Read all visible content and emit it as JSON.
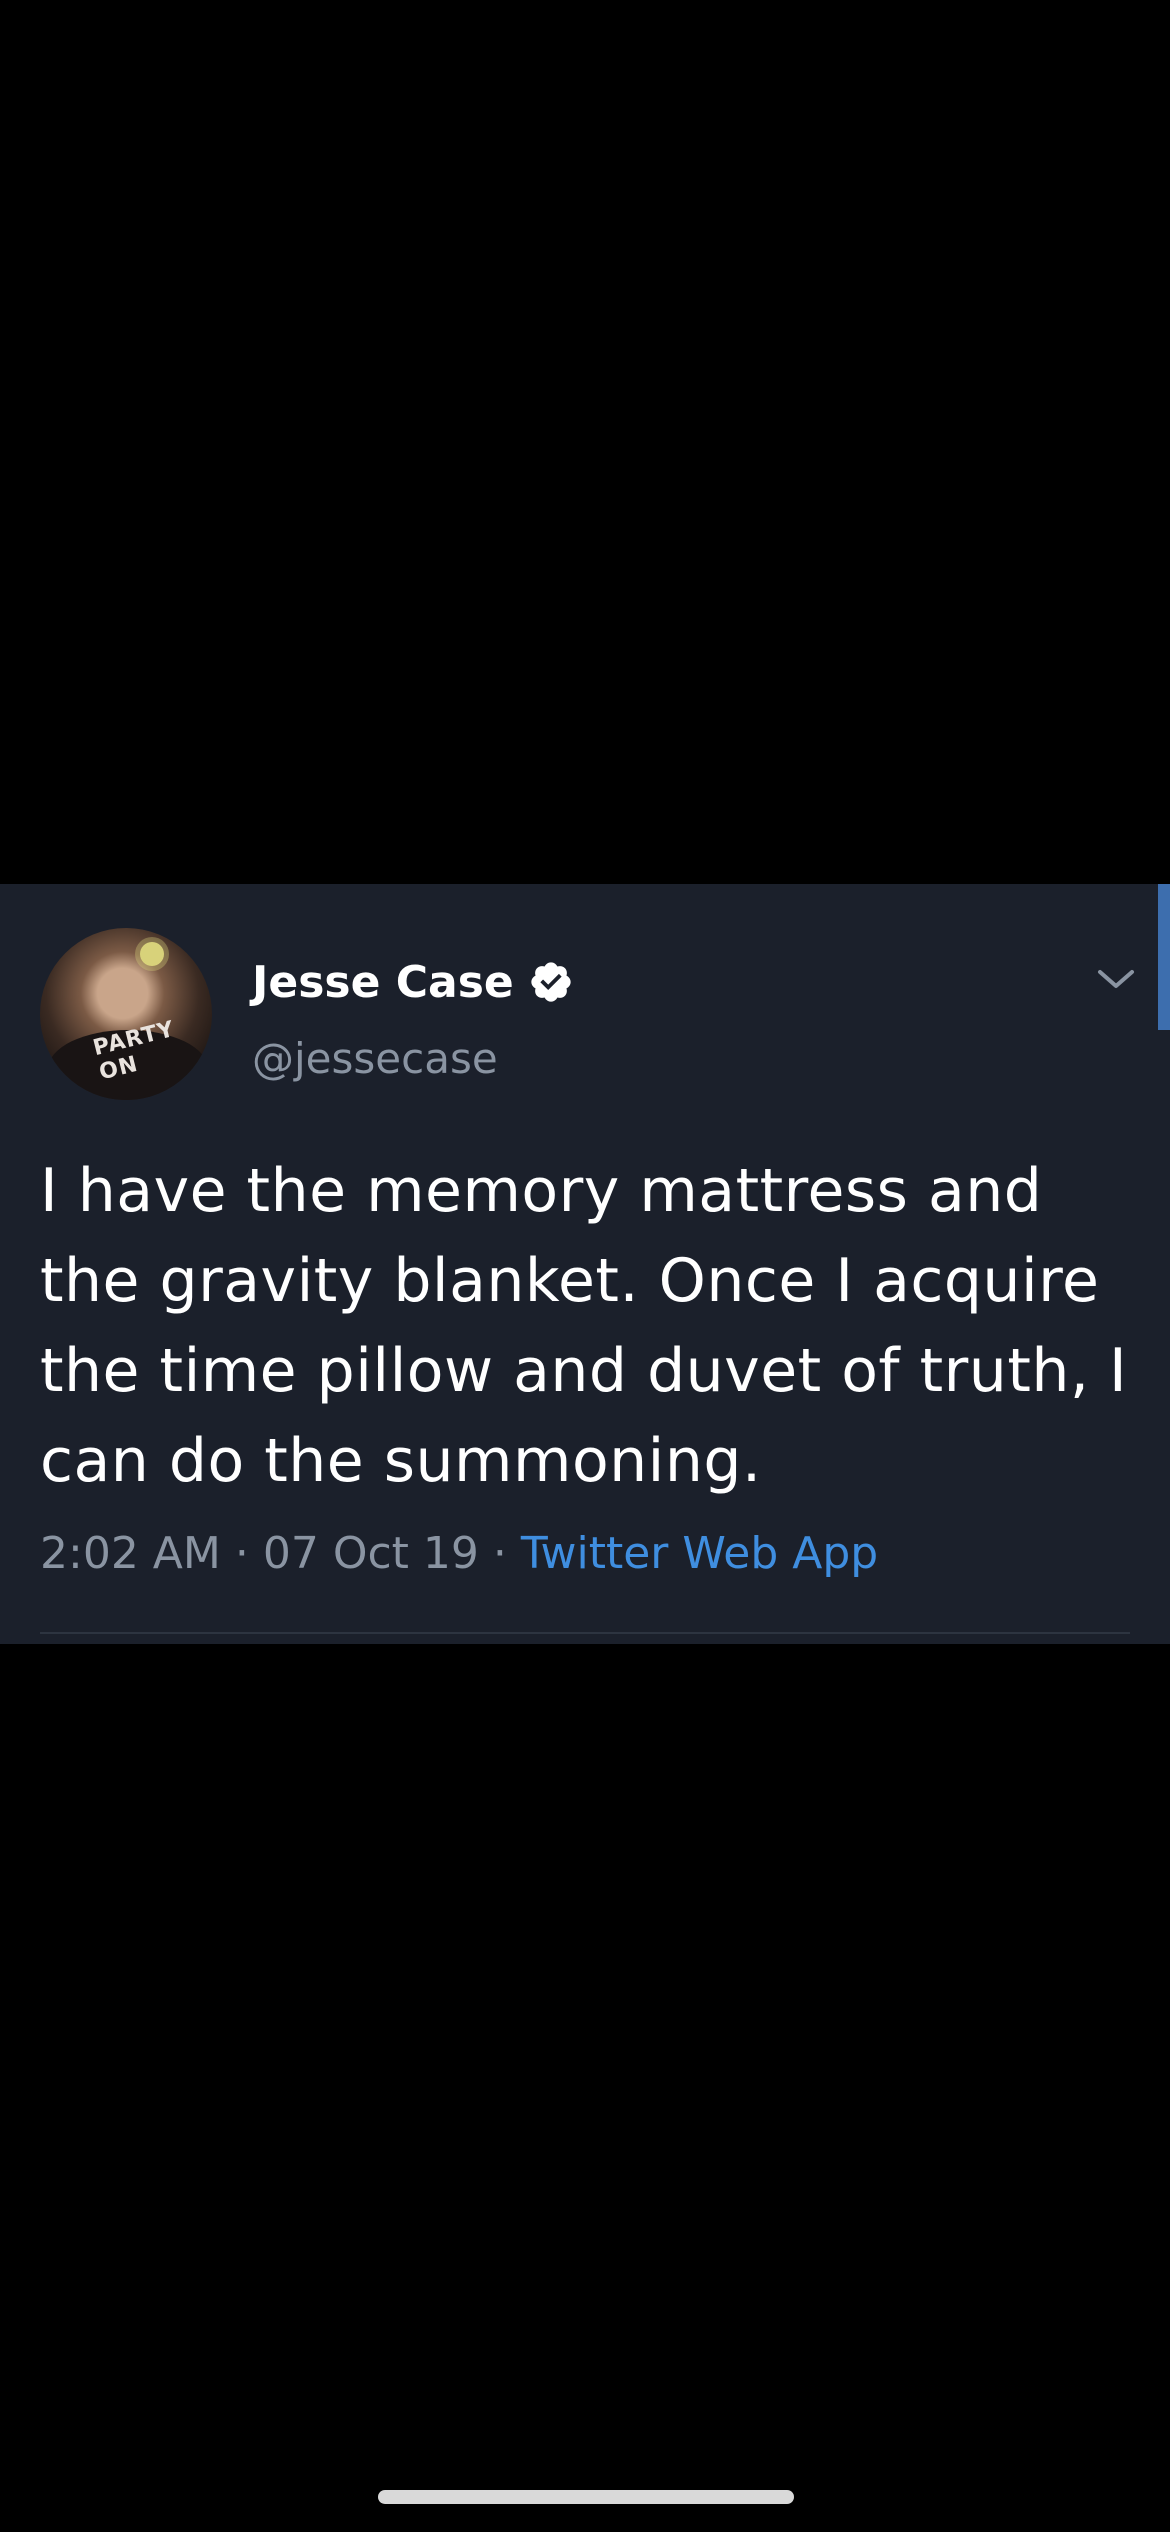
{
  "tweet": {
    "author": {
      "display_name": "Jesse Case",
      "handle": "@jessecase",
      "verified": true,
      "avatar_shirt_text": "PARTY ON"
    },
    "text": "I have the memory mattress and the gravity blanket. Once I acquire the time pillow and duvet of truth, I can do the summoning.",
    "time": "2:02 AM",
    "date": "07 Oct 19",
    "separator": "·",
    "source": "Twitter Web App"
  },
  "icons": {
    "verified": "verified-badge-icon",
    "menu": "chevron-down-icon"
  },
  "colors": {
    "background": "#000000",
    "card": "#1b202b",
    "text_primary": "#ffffff",
    "text_secondary": "#8a94a2",
    "link": "#3f8ee0",
    "scroll_indicator": "#3d6eae"
  }
}
